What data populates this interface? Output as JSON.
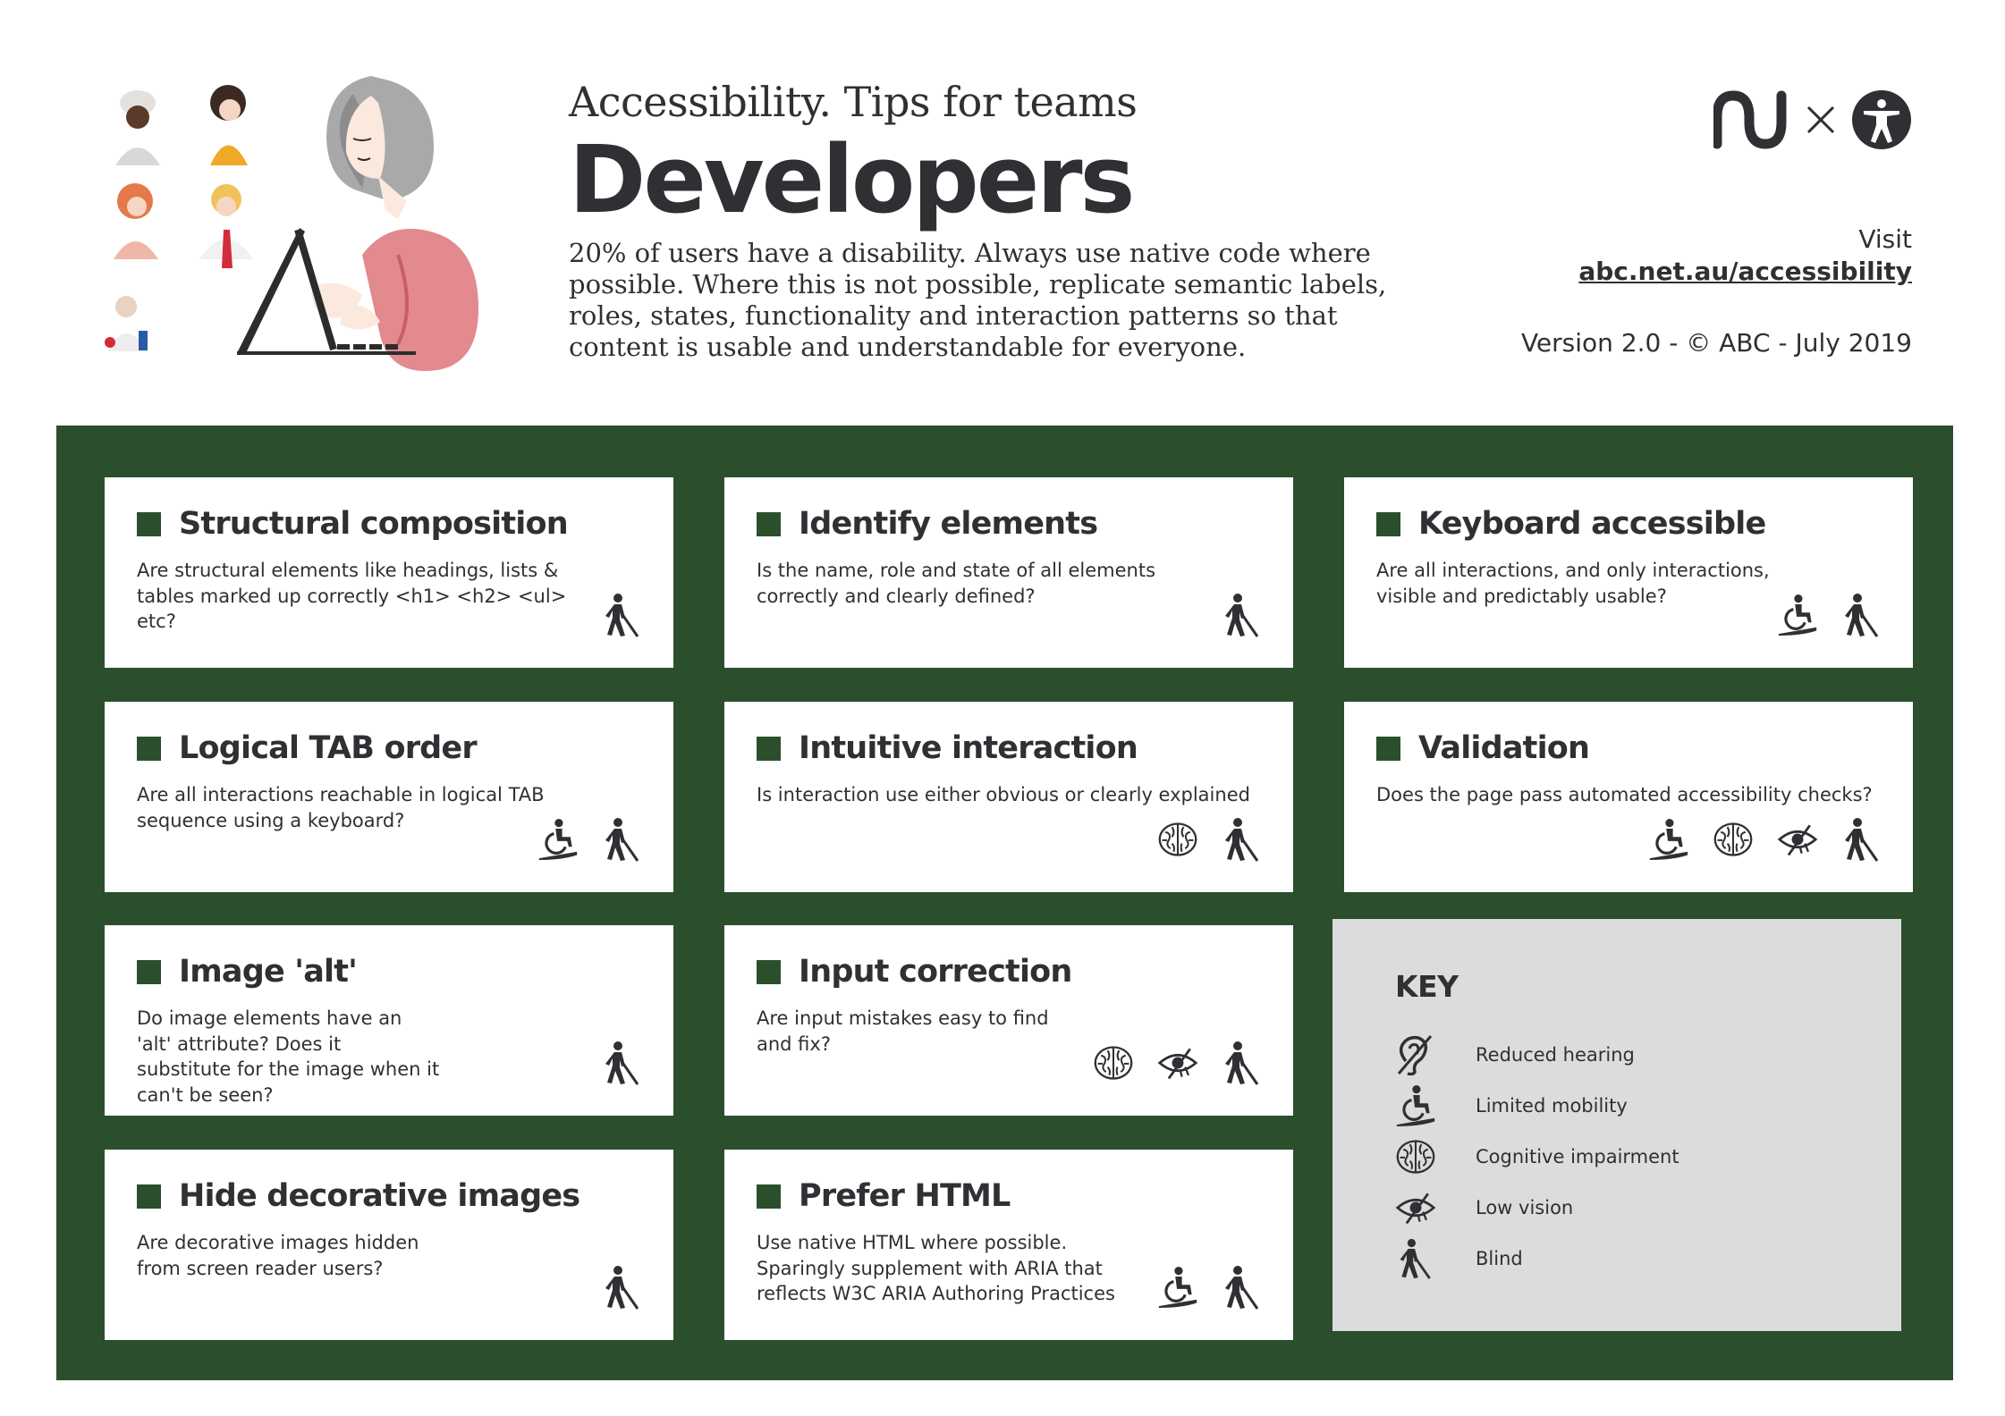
{
  "header": {
    "kicker": "Accessibility. Tips for teams",
    "title": "Developers",
    "intro": "20% of users have a disability. Always use native code where possible. Where this is not possible, replicate semantic labels, roles, states, functionality and interaction patterns so that content is usable and understandable for everyone.",
    "visit_label": "Visit",
    "visit_link": "abc.net.au/accessibility",
    "version": "Version 2.0 - © ABC - July 2019",
    "logos": [
      "abc-logo-icon",
      "times-icon",
      "accessibility-icon"
    ]
  },
  "cards": [
    {
      "title": "Structural composition",
      "desc": "Are structural elements like headings, lists & tables marked up correctly <h1> <h2> <ul> etc?",
      "icons": [
        "blind"
      ]
    },
    {
      "title": "Identify elements",
      "desc": "Is the name, role and state of all elements correctly and clearly defined?",
      "icons": [
        "blind"
      ]
    },
    {
      "title": "Keyboard accessible",
      "desc": "Are all interactions, and only interactions, visible and predictably usable?",
      "icons": [
        "mobility",
        "blind"
      ]
    },
    {
      "title": "Logical TAB order",
      "desc": "Are all interactions reachable in logical TAB sequence using a keyboard?",
      "icons": [
        "mobility",
        "blind"
      ]
    },
    {
      "title": "Intuitive interaction",
      "desc": "Is interaction use either obvious or clearly explained",
      "icons": [
        "cognitive",
        "blind"
      ]
    },
    {
      "title": "Validation",
      "desc": "Does the page pass automated accessibility checks?",
      "icons": [
        "mobility",
        "cognitive",
        "lowvision",
        "blind"
      ]
    },
    {
      "title": "Image 'alt'",
      "desc": "Do image elements have an 'alt' attribute? Does it substitute for the image when it can't be seen?",
      "icons": [
        "blind"
      ]
    },
    {
      "title": "Input correction",
      "desc": "Are input mistakes easy to find and fix?",
      "icons": [
        "cognitive",
        "lowvision",
        "blind"
      ]
    },
    {
      "title": "Hide decorative images",
      "desc": "Are decorative images hidden from screen reader users?",
      "icons": [
        "blind"
      ]
    },
    {
      "title": "Prefer HTML",
      "desc": "Use native HTML where possible. Sparingly supplement with ARIA that reflects W3C ARIA Authoring Practices",
      "icons": [
        "mobility",
        "blind"
      ]
    }
  ],
  "key": {
    "title": "KEY",
    "items": [
      {
        "icon": "hearing",
        "label": "Reduced hearing"
      },
      {
        "icon": "mobility",
        "label": "Limited mobility"
      },
      {
        "icon": "cognitive",
        "label": "Cognitive impairment"
      },
      {
        "icon": "lowvision",
        "label": "Low vision"
      },
      {
        "icon": "blind",
        "label": "Blind"
      }
    ]
  },
  "colors": {
    "board": "#2b4f2d",
    "text": "#2f3033",
    "key_bg": "#dcdcdc"
  }
}
